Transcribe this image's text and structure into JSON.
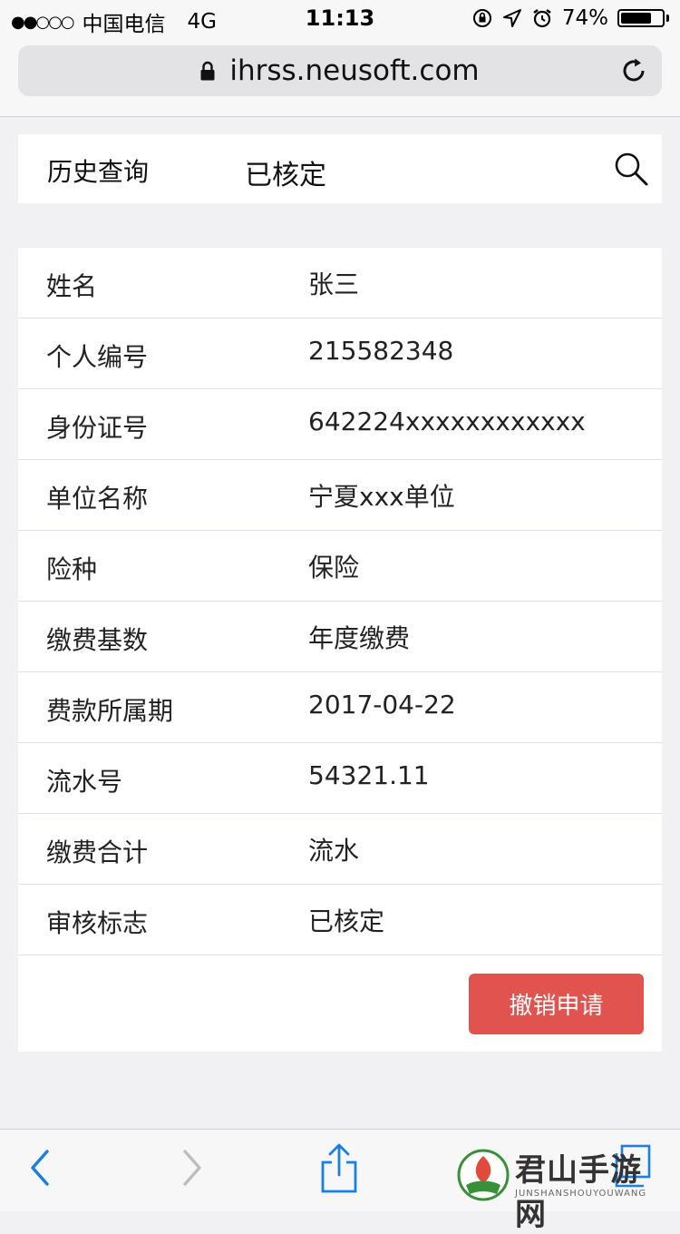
{
  "status_bar": {
    "signal": "●●○○○",
    "carrier": "中国电信",
    "network": "4G",
    "time": "11:13",
    "battery_percent": "74%",
    "battery_level": 0.74
  },
  "browser": {
    "url": "ihrss.neusoft.com"
  },
  "filter": {
    "history_label": "历史查询",
    "status_label": "已核定"
  },
  "details": [
    {
      "label": "姓名",
      "value": "张三"
    },
    {
      "label": "个人编号",
      "value": "215582348"
    },
    {
      "label": "身份证号",
      "value": "642224xxxxxxxxxxxx"
    },
    {
      "label": "单位名称",
      "value": "宁夏xxx单位"
    },
    {
      "label": "险种",
      "value": "保险"
    },
    {
      "label": "缴费基数",
      "value": "年度缴费"
    },
    {
      "label": "费款所属期",
      "value": "2017-04-22"
    },
    {
      "label": "流水号",
      "value": "54321.11"
    },
    {
      "label": "缴费合计",
      "value": "流水"
    },
    {
      "label": "审核标志",
      "value": "已核定"
    }
  ],
  "actions": {
    "cancel_label": "撤销申请"
  },
  "watermark": {
    "title": "君山手游网",
    "subtitle": "JUNSHANSHOUYOUWANG"
  },
  "colors": {
    "accent_button": "#e0534f",
    "toolbar_blue": "#1a7fe0"
  }
}
